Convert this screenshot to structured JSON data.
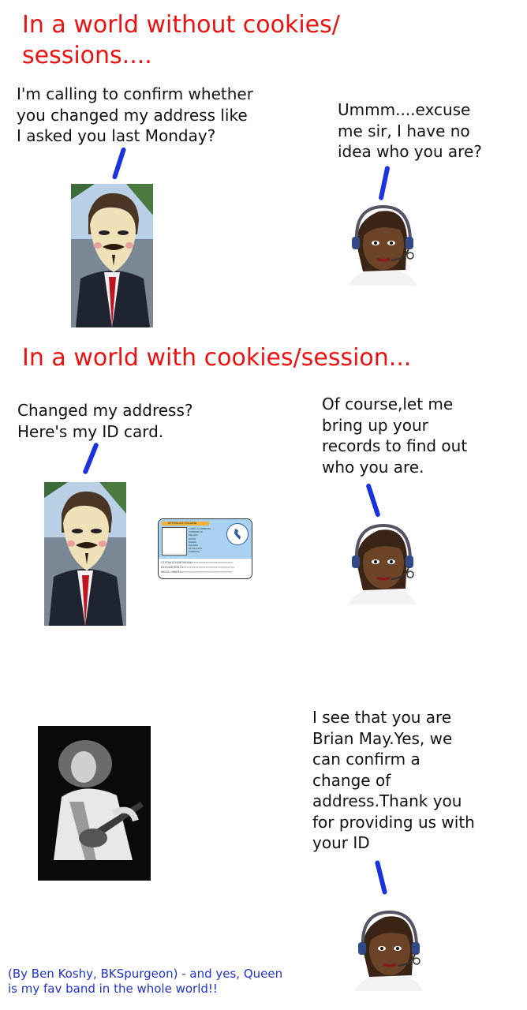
{
  "panel1": {
    "heading": "In a world without cookies/\nsessions....",
    "caller_text": "I'm calling to confirm whether\nyou changed my address like\nI asked you last Monday?",
    "agent_text": "Ummm....excuse\nme sir, I have no\nidea who you are?"
  },
  "panel2": {
    "heading": "In a world with cookies/session...",
    "caller_text": "Changed my address?\nHere's my ID card.",
    "agent_text": "Of course,let me\nbring up your\nrecords to find out\nwho you are.",
    "id_card": {
      "header": "REPUBLICA ITALIANA",
      "lines": [
        "CARTA DI IDENTITA",
        "COMUNE DI",
        "MILANO",
        "ROSSI",
        "MARIA",
        "MILANO",
        "01/01/1970",
        "CS89XXA"
      ],
      "mrz": [
        "CIITA0123456789AA0<<<<<<<<<<<<<<<<<<<<<<<<",
        "0123456789ITA<<<<<<<<<<<<<<<<<<<<<<<<<<<<<<",
        "ROSSI<<MARIA<<<<<<<<<<<<<<<<<<<<<<<<<<<<<<"
      ]
    }
  },
  "panel3": {
    "agent_text": "I see that you are\nBrian May.Yes, we\ncan confirm a\nchange of\naddress.Thank you\nfor providing us with\nyour ID"
  },
  "credit": "(By Ben Koshy, BKSpurgeon) - and yes, Queen\nis my fav band in the whole world!!",
  "colors": {
    "heading": "#ee1111",
    "tail": "#1a33dd",
    "credit": "#2233cc"
  }
}
